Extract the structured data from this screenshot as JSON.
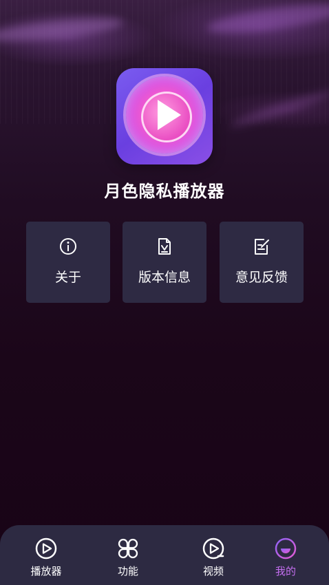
{
  "app": {
    "title": "月色隐私播放器"
  },
  "menu": [
    {
      "label": "关于",
      "icon": "info-icon"
    },
    {
      "label": "版本信息",
      "icon": "version-doc-icon"
    },
    {
      "label": "意见反馈",
      "icon": "feedback-edit-icon"
    }
  ],
  "tabbar": {
    "active_index": 3,
    "items": [
      {
        "label": "播放器",
        "icon": "play-circle-icon"
      },
      {
        "label": "功能",
        "icon": "four-loops-icon"
      },
      {
        "label": "视频",
        "icon": "video-play-icon"
      },
      {
        "label": "我的",
        "icon": "profile-smile-icon"
      }
    ]
  },
  "colors": {
    "background": "#1b0a1a",
    "card": "#2e2a43",
    "tabbar": "#2d2a42",
    "accent": "#c56ff0",
    "logo_gradient": "#7a5cf0"
  }
}
